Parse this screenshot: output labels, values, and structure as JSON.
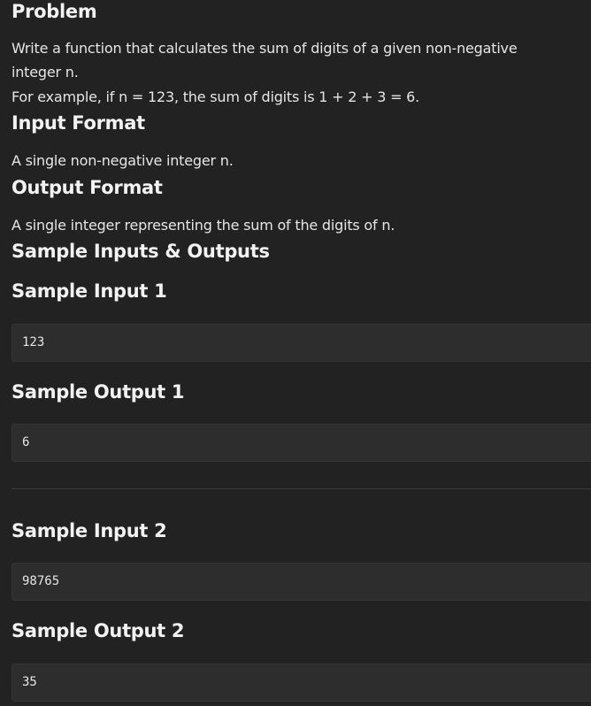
{
  "problem": {
    "heading": "Problem",
    "line1": "Write a function that calculates the sum of digits of a given non-negative",
    "line2": "integer n.",
    "line3": "For example, if n = 123, the sum of digits is 1 + 2 + 3 = 6."
  },
  "input_format": {
    "heading": "Input Format",
    "text": "A single non-negative integer n."
  },
  "output_format": {
    "heading": "Output Format",
    "text": "A single integer representing the sum of the digits of n."
  },
  "samples": {
    "heading": "Sample Inputs & Outputs",
    "items": [
      {
        "input_heading": "Sample Input 1",
        "input_value": "123",
        "output_heading": "Sample Output 1",
        "output_value": "6"
      },
      {
        "input_heading": "Sample Input 2",
        "input_value": "98765",
        "output_heading": "Sample Output 2",
        "output_value": "35"
      }
    ]
  }
}
